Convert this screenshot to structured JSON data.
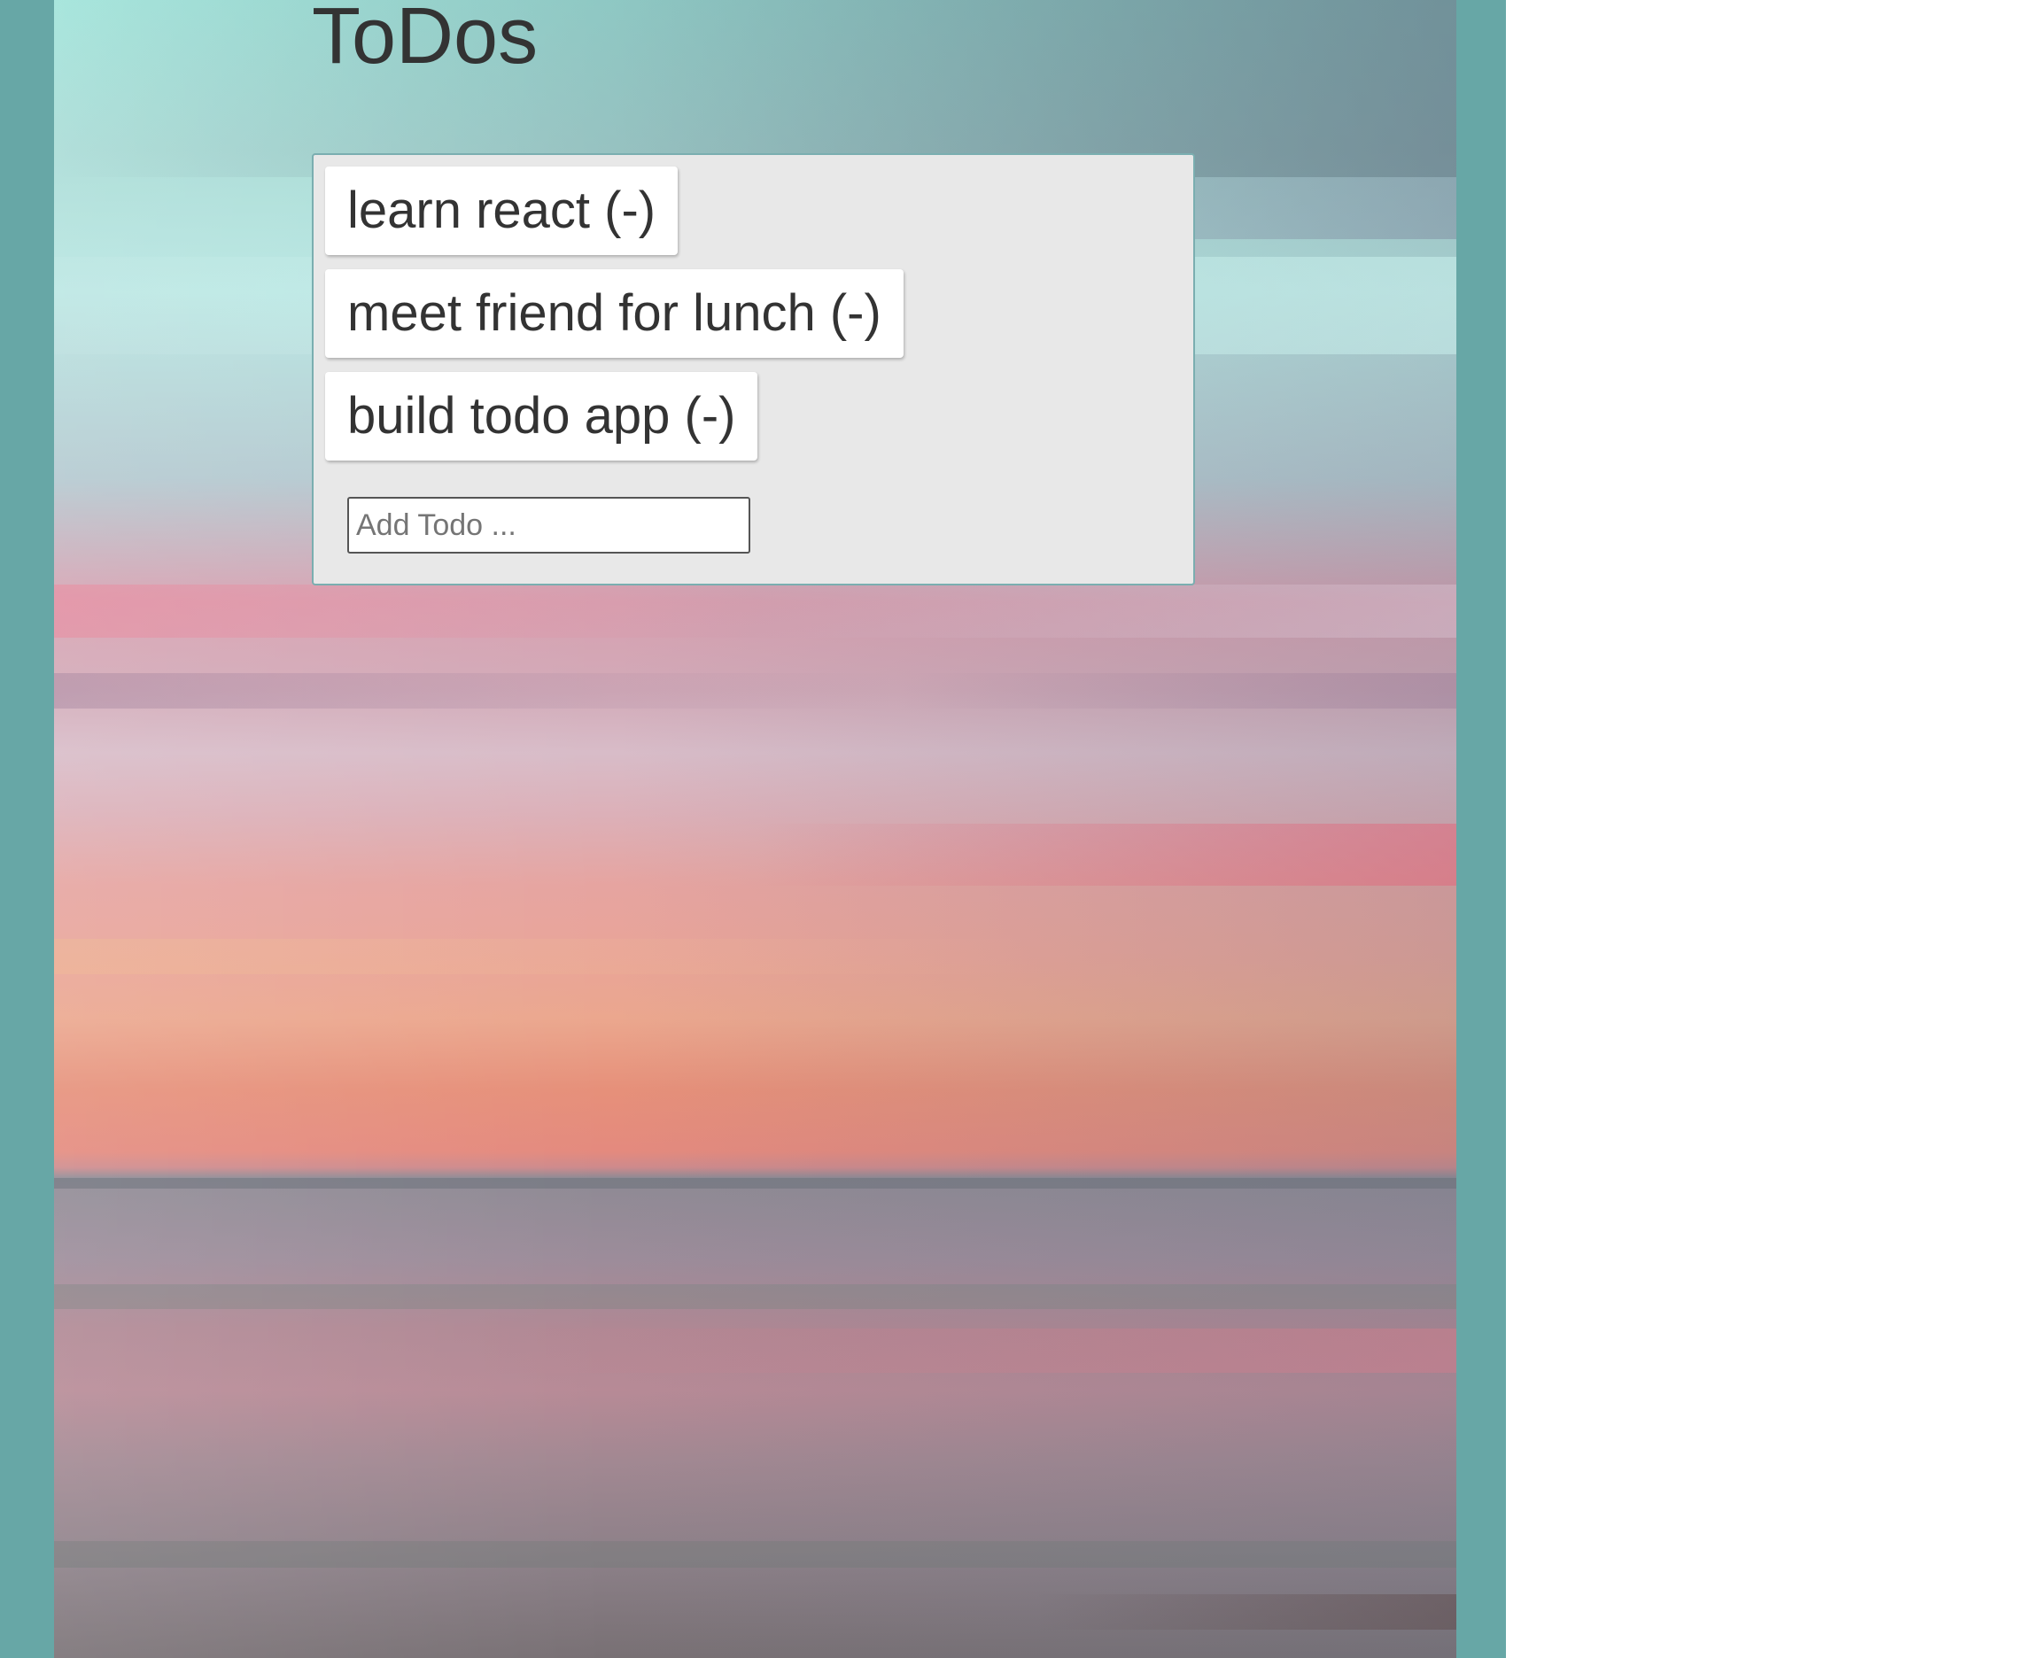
{
  "page": {
    "title": "ToDos"
  },
  "todos": {
    "items": [
      {
        "label": "learn react (-)"
      },
      {
        "label": "meet friend for lunch (-)"
      },
      {
        "label": "build todo app (-)"
      }
    ],
    "add_input": {
      "value": "",
      "placeholder": "Add Todo ..."
    }
  },
  "colors": {
    "frame": "#67a7a6",
    "panel": "#e8e8e8",
    "panel_border": "#7aaeb0",
    "item_bg": "#ffffff",
    "text": "#333333"
  }
}
